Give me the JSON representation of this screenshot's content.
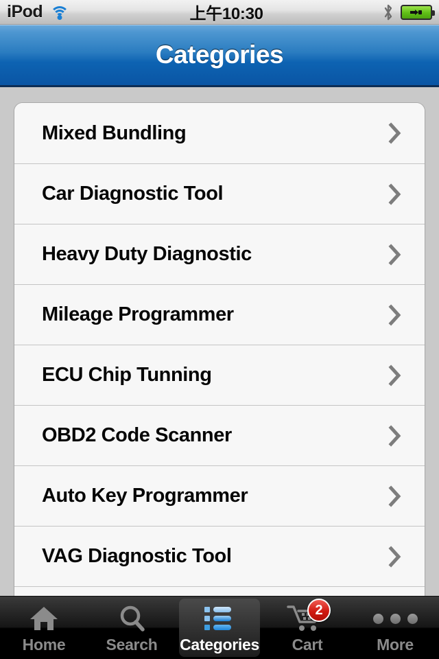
{
  "status_bar": {
    "carrier": "iPod",
    "wifi_icon": "wifi-icon",
    "time": "上午10:30",
    "bluetooth_icon": "bluetooth-icon",
    "battery_icon": "battery-charging-icon"
  },
  "nav": {
    "title": "Categories"
  },
  "list": {
    "items": [
      {
        "label": "Mixed Bundling"
      },
      {
        "label": "Car Diagnostic Tool"
      },
      {
        "label": "Heavy Duty Diagnostic"
      },
      {
        "label": "Mileage Programmer"
      },
      {
        "label": "ECU Chip Tunning"
      },
      {
        "label": "OBD2 Code Scanner"
      },
      {
        "label": "Auto Key Programmer"
      },
      {
        "label": "VAG Diagnostic Tool"
      },
      {
        "label": ""
      }
    ],
    "accessory_icon": "chevron-right-icon"
  },
  "tabbar": {
    "tabs": [
      {
        "label": "Home",
        "icon": "home-icon",
        "active": false
      },
      {
        "label": "Search",
        "icon": "search-icon",
        "active": false
      },
      {
        "label": "Categories",
        "icon": "list-icon",
        "active": true
      },
      {
        "label": "Cart",
        "icon": "cart-icon",
        "active": false,
        "badge": "2"
      },
      {
        "label": "More",
        "icon": "ellipsis-icon",
        "active": false
      }
    ]
  },
  "colors": {
    "nav_top": "#6aa9db",
    "nav_bottom": "#0a55a4",
    "page_background": "#c9c9c9",
    "row_background": "#f7f7f7",
    "badge_red": "#d01a12",
    "accent_blue": "#1a7fd4"
  }
}
